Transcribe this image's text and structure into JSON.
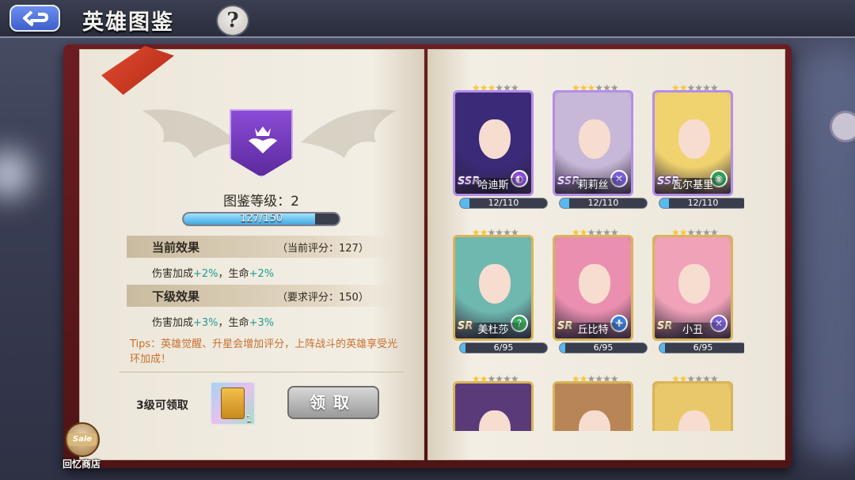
{
  "header": {
    "title": "英雄图鉴"
  },
  "codex": {
    "level_label": "图鉴等级：2",
    "progress_text": "127/150",
    "progress_fraction": 0.847,
    "current_title": "当前效果",
    "current_score": "（当前评分：127）",
    "current_effect_prefix": "伤害加成",
    "current_effect_dmg": "+2%",
    "current_effect_mid": "，生命",
    "current_effect_hp": "+2%",
    "next_title": "下级效果",
    "next_score": "（要求评分：150）",
    "next_effect_prefix": "伤害加成",
    "next_effect_dmg": "+3%",
    "next_effect_mid": "，生命",
    "next_effect_hp": "+3%",
    "tips": "Tips：英雄觉醒、升星会增加评分，上阵战斗的英雄享受光环加成！",
    "reward_label": "3级可领取",
    "reward_count": "1",
    "claim_label": "领取"
  },
  "shop": {
    "sale_tag": "Sale",
    "label": "回忆商店"
  },
  "colors": {
    "ssr_frame": "#b58ee8",
    "sr_frame": "#d9b45a",
    "accent_green": "#1f9e8f",
    "tips_orange": "#c8702c"
  },
  "heroes": [
    {
      "name": "哈迪斯",
      "rank": "SSR",
      "stars": 3,
      "progress": "12/110",
      "progress_fraction": 0.11,
      "role_icon": "mage-icon",
      "hair": "#3b2a78"
    },
    {
      "name": "莉莉丝",
      "rank": "SSR",
      "stars": 3,
      "progress": "12/110",
      "progress_fraction": 0.11,
      "role_icon": "assassin-icon",
      "hair": "#c8b8d8"
    },
    {
      "name": "瓦尔基里",
      "rank": "SSR",
      "stars": 2,
      "progress": "12/110",
      "progress_fraction": 0.11,
      "role_icon": "warrior-icon",
      "hair": "#f0d36e"
    },
    {
      "name": "美杜莎",
      "rank": "SR",
      "stars": 2,
      "progress": "6/95",
      "progress_fraction": 0.063,
      "role_icon": "support-icon",
      "hair": "#6fb8b0"
    },
    {
      "name": "丘比特",
      "rank": "SR",
      "stars": 2,
      "progress": "6/95",
      "progress_fraction": 0.063,
      "role_icon": "healer-icon",
      "hair": "#eb8fb0"
    },
    {
      "name": "小丑",
      "rank": "SR",
      "stars": 2,
      "progress": "6/95",
      "progress_fraction": 0.063,
      "role_icon": "assassin-icon",
      "hair": "#f0a2b8"
    },
    {
      "name": "",
      "rank": "",
      "stars": 2,
      "progress": "",
      "progress_fraction": 0,
      "role_icon": "",
      "hair": "#5b3a7a"
    },
    {
      "name": "",
      "rank": "",
      "stars": 2,
      "progress": "",
      "progress_fraction": 0,
      "role_icon": "",
      "hair": "#b88656"
    },
    {
      "name": "",
      "rank": "",
      "stars": 2,
      "progress": "",
      "progress_fraction": 0,
      "role_icon": "",
      "hair": "#e8c86a"
    }
  ]
}
